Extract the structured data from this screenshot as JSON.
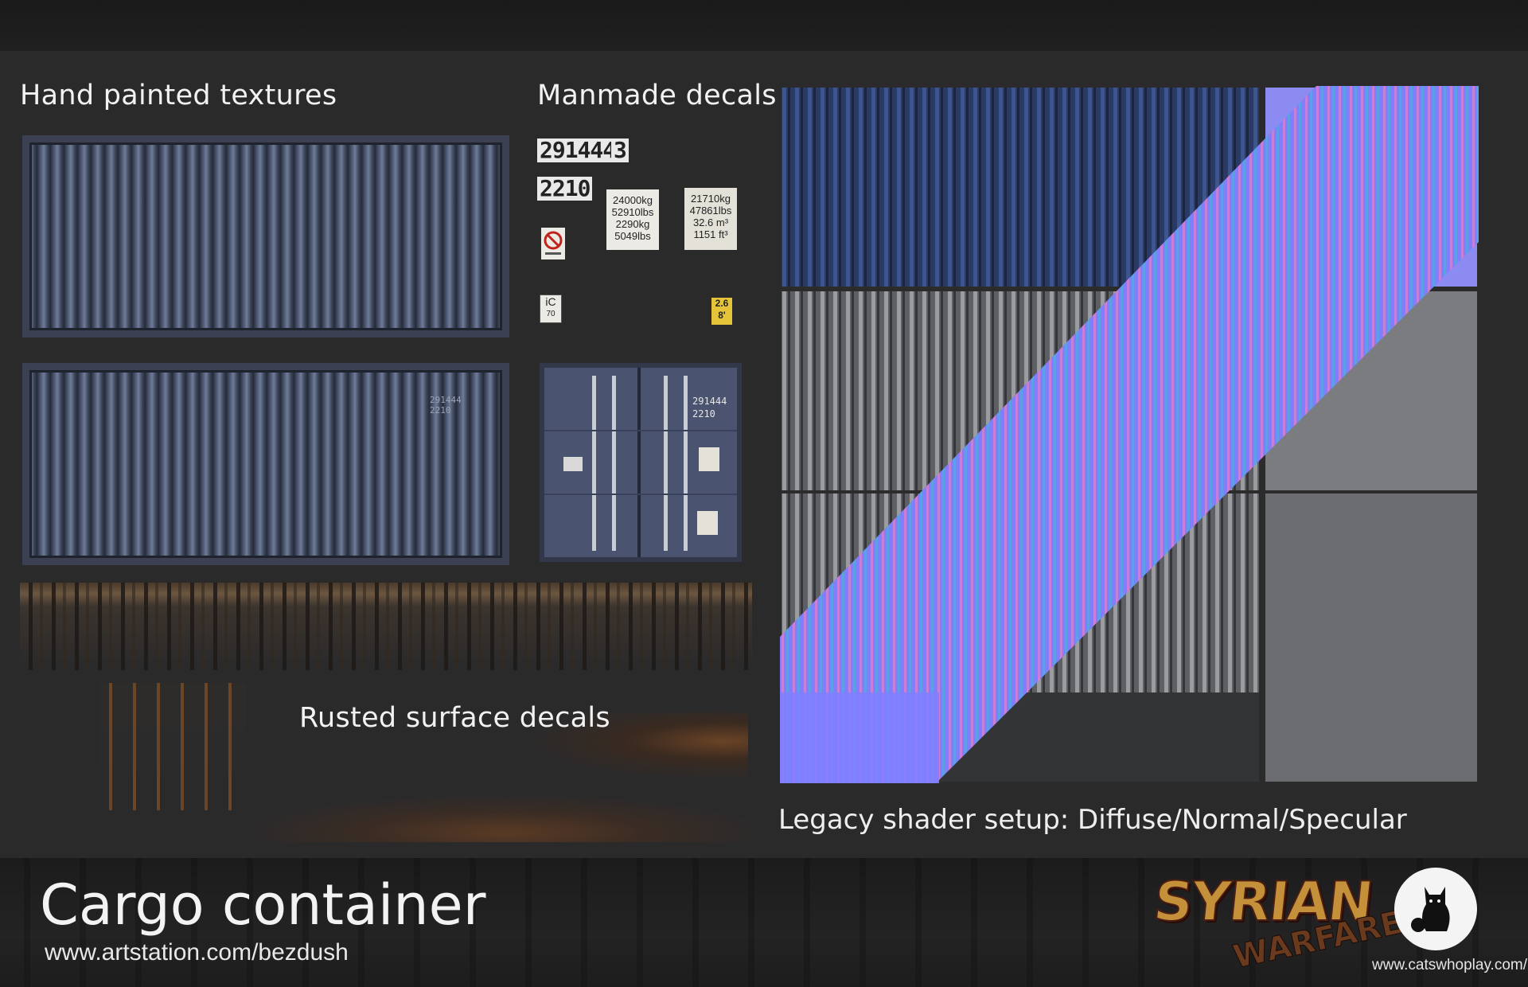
{
  "headings": {
    "hand_painted": "Hand painted textures",
    "manmade": "Manmade decals",
    "rusted": "Rusted surface decals",
    "shader": "Legacy shader setup:  Diffuse/Normal/Specular"
  },
  "decals": {
    "serial": "291444",
    "check_digit": "3",
    "type_code": "2210",
    "weights_a": [
      "24000kg",
      "52910lbs",
      "2290kg",
      "5049lbs"
    ],
    "weights_b": [
      "21710kg",
      "47861lbs",
      "32.6 m³",
      "1151 ft³"
    ],
    "ic_label": "iC",
    "ic_sub": "70",
    "height_label": [
      "2.6",
      "8'"
    ]
  },
  "footer": {
    "title": "Cargo container",
    "url": "www.artstation.com/bezdush",
    "publisher_url": "www.catswhoplay.com/",
    "game_logo_top": "SYRIAN",
    "game_logo_bottom": "WARFARE"
  },
  "colors": {
    "background": "#2a2a2b",
    "container_blue": "#4b5670",
    "normal_map": "#7f7fff",
    "rust": "#7a4f2a"
  },
  "icons": [
    "no-fire-icon",
    "cat-logo-icon"
  ]
}
